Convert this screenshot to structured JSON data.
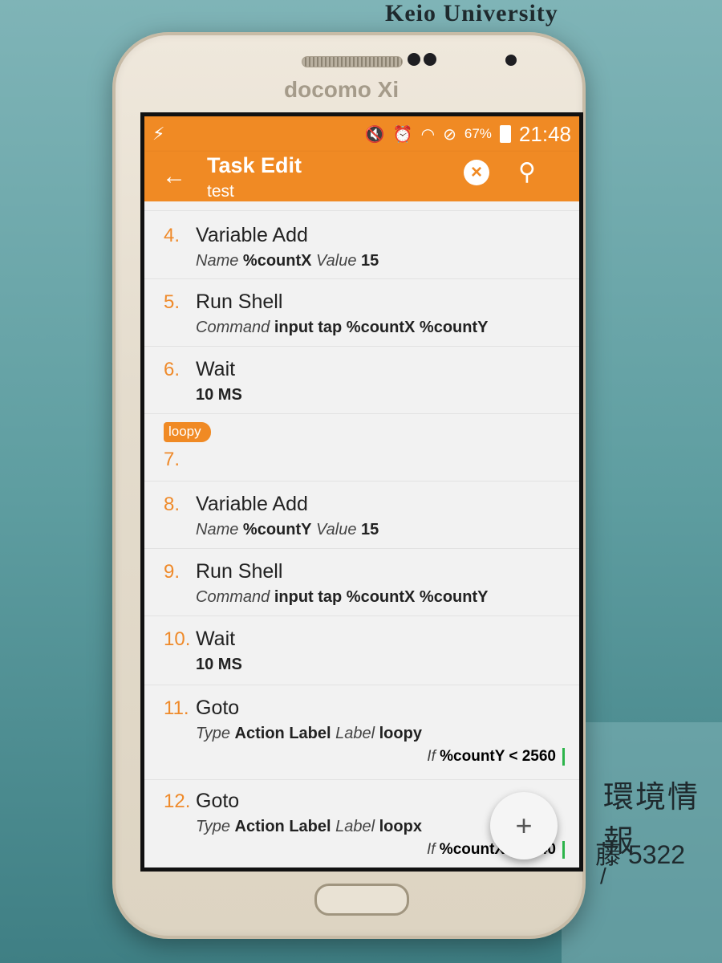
{
  "background": {
    "university": "Keio University",
    "poster_text": "環境情報",
    "poster_phone": "藤 5322",
    "poster_slash": "/"
  },
  "phone": {
    "brand": "docomo Xi"
  },
  "statusbar": {
    "battery": "67%",
    "time": "21:48"
  },
  "appbar": {
    "title": "Task Edit",
    "subtitle": "test"
  },
  "actions": [
    {
      "num": "4.",
      "name": "Variable Add",
      "params": [
        {
          "key": "Name",
          "val": "%countX"
        },
        {
          "key": "Value",
          "val": "15"
        }
      ]
    },
    {
      "num": "5.",
      "name": "Run Shell",
      "params": [
        {
          "key": "Command",
          "val": "input tap %countX %countY"
        }
      ]
    },
    {
      "num": "6.",
      "name": "Wait",
      "params": [
        {
          "key": "",
          "val": "10 MS"
        }
      ]
    },
    {
      "label": "loopy",
      "num": "7.",
      "name": ""
    },
    {
      "num": "8.",
      "name": "Variable Add",
      "params": [
        {
          "key": "Name",
          "val": "%countY"
        },
        {
          "key": "Value",
          "val": "15"
        }
      ]
    },
    {
      "num": "9.",
      "name": "Run Shell",
      "params": [
        {
          "key": "Command",
          "val": "input tap %countX %countY"
        }
      ]
    },
    {
      "num": "10.",
      "name": "Wait",
      "params": [
        {
          "key": "",
          "val": "10 MS"
        }
      ]
    },
    {
      "num": "11.",
      "name": "Goto",
      "params": [
        {
          "key": "Type",
          "val": "Action Label"
        },
        {
          "key": "Label",
          "val": "loopy"
        }
      ],
      "cond": {
        "key": "If",
        "val": "%countY < 2560"
      }
    },
    {
      "num": "12.",
      "name": "Goto",
      "params": [
        {
          "key": "Type",
          "val": "Action Label"
        },
        {
          "key": "Label",
          "val": "loopx"
        }
      ],
      "cond": {
        "key": "If",
        "val": "%countX < 1440"
      }
    }
  ],
  "fab": {
    "symbol": "+"
  },
  "colors": {
    "accent": "#f08a24",
    "number": "#ef8a2a",
    "cond_bar": "#2cb44a"
  }
}
